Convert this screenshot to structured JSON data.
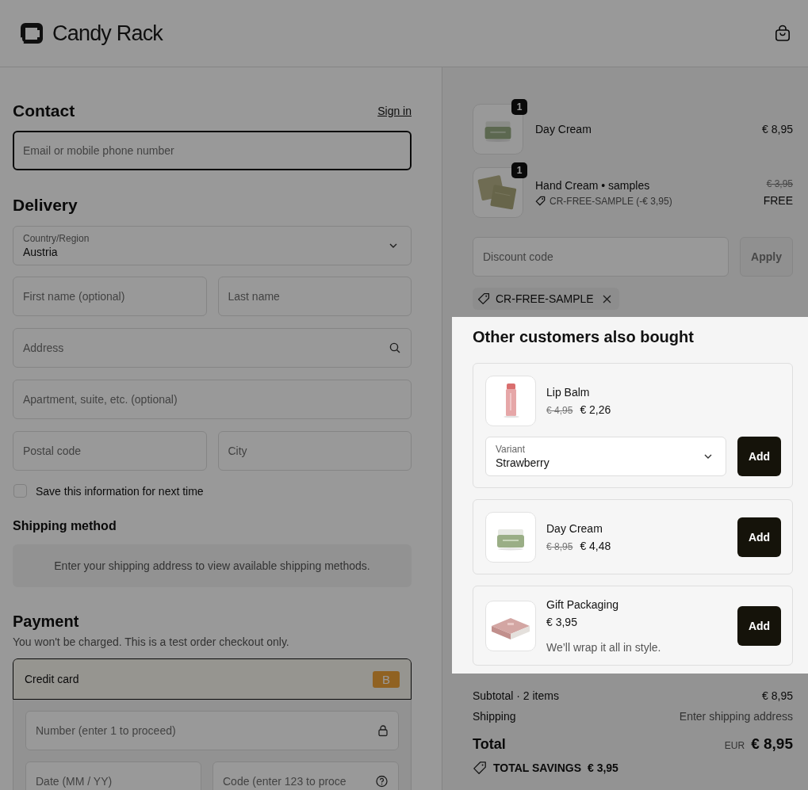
{
  "header": {
    "logo": "Candy Rack"
  },
  "contact": {
    "title": "Contact",
    "sign_in": "Sign in",
    "email": {
      "placeholder": "Email or mobile phone number"
    }
  },
  "delivery": {
    "title": "Delivery",
    "country": {
      "label": "Country/Region",
      "value": "Austria"
    },
    "field_rows": [
      [
        {
          "placeholder": "First name (optional)"
        },
        {
          "placeholder": "Last name"
        }
      ],
      [
        {
          "placeholder": "Address"
        }
      ],
      [
        {
          "placeholder": "Apartment, suite, etc. (optional)"
        }
      ],
      [
        {
          "placeholder": "Postal code"
        },
        {
          "placeholder": "City"
        }
      ]
    ],
    "save_info": {
      "label": "Save this information for next time",
      "checked": false
    }
  },
  "shipping_method": {
    "title": "Shipping method",
    "message": "Enter your shipping address to view available shipping methods."
  },
  "payment": {
    "title": "Payment",
    "note": "You won't be charged. This is a test order checkout only.",
    "methods": [
      {
        "label": "Credit card",
        "badge": "B",
        "selected": true
      }
    ],
    "card_field_rows": [
      [
        {
          "placeholder": "Number (enter 1 to proceed)"
        }
      ],
      [
        {
          "placeholder": "Date (MM / YY)"
        },
        {
          "placeholder": "Code (enter 123 to proce"
        }
      ]
    ]
  },
  "order": {
    "items": [
      {
        "name": "Day Cream",
        "quantity": "1",
        "price": "€ 8,95"
      },
      {
        "name": "Hand Cream • samples",
        "quantity": "1",
        "discount": "CR-FREE-SAMPLE (-€ 3,95)",
        "original_price": "€ 3,95",
        "price": "FREE"
      }
    ],
    "discount_field": {
      "placeholder": "Discount code"
    },
    "apply_button": {
      "label": "Apply",
      "disabled": true
    },
    "applied_codes": [
      "CR-FREE-SAMPLE"
    ]
  },
  "upsell": {
    "title": "Other customers also bought",
    "products": [
      {
        "name": "Lip Balm",
        "original_price": "€ 4,95",
        "price": "€ 2,26",
        "variant": {
          "label": "Variant",
          "value": "Strawberry"
        },
        "button": "Add"
      },
      {
        "name": "Day Cream",
        "original_price": "€ 8,95",
        "price": "€ 4,48",
        "button": "Add"
      },
      {
        "name": "Gift Packaging",
        "price": "€ 3,95",
        "note": "We’ll wrap it all in style.",
        "button": "Add"
      }
    ]
  },
  "summary": {
    "subtotal_label": "Subtotal · 2 items",
    "subtotal": "€ 8,95",
    "shipping_label": "Shipping",
    "shipping": "Enter shipping address",
    "total_label": "Total",
    "currency": "EUR",
    "total": "€ 8,95",
    "savings_label": "TOTAL SAVINGS",
    "savings": "€ 3,95"
  }
}
